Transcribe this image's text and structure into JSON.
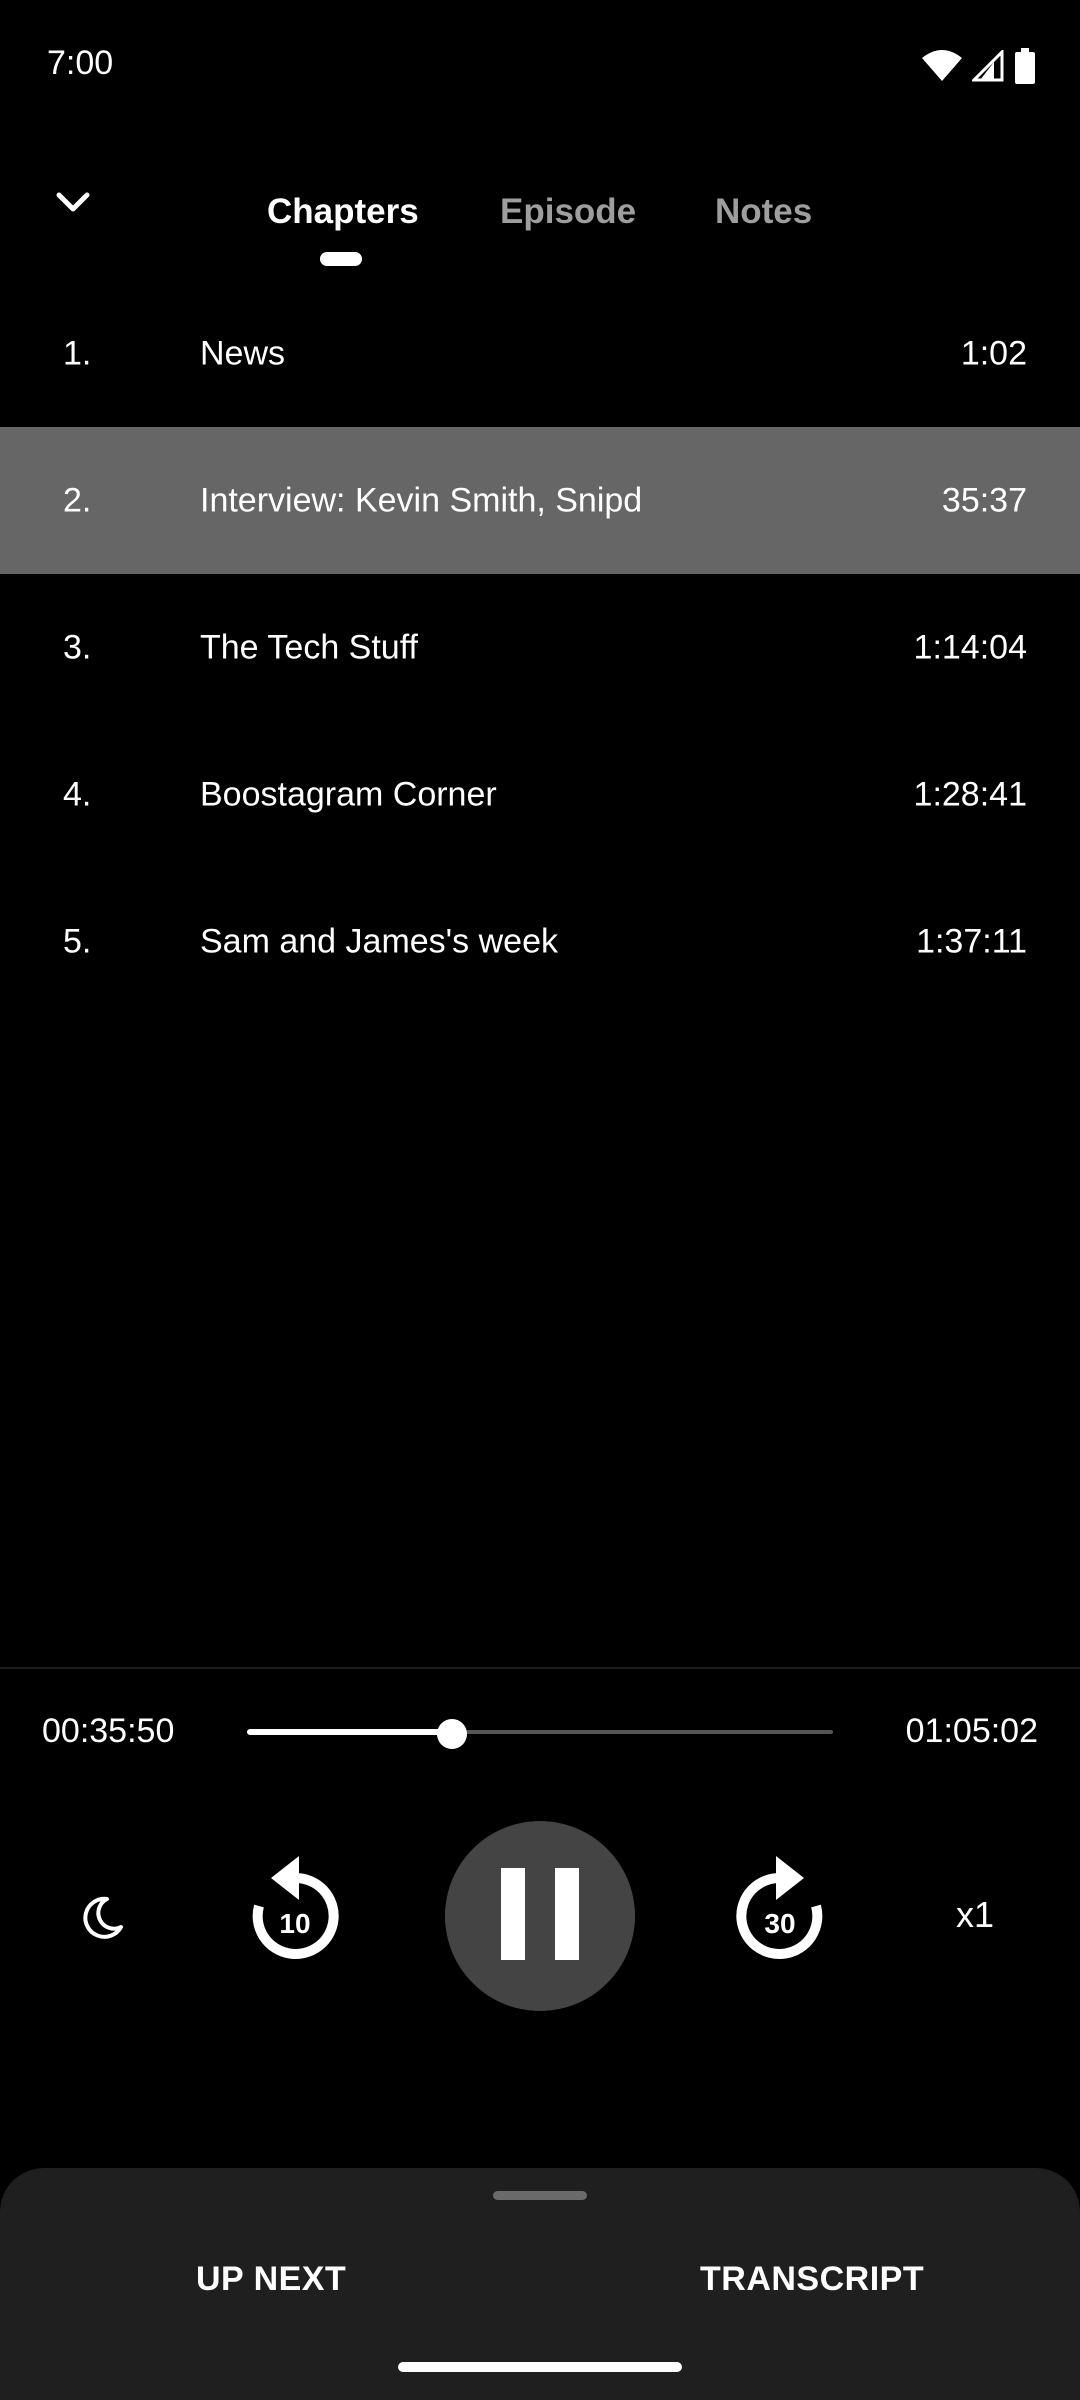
{
  "status_bar": {
    "time": "7:00",
    "icons": [
      "wifi-icon",
      "signal-icon",
      "battery-icon"
    ]
  },
  "header": {
    "collapse_icon": "chevron-down-icon",
    "tabs": [
      {
        "label": "Chapters",
        "active": true
      },
      {
        "label": "Episode",
        "active": false
      },
      {
        "label": "Notes",
        "active": false
      }
    ]
  },
  "chapters": [
    {
      "number": "1.",
      "title": "News",
      "time": "1:02",
      "selected": false
    },
    {
      "number": "2.",
      "title": "Interview: Kevin Smith, Snipd",
      "time": "35:37",
      "selected": true
    },
    {
      "number": "3.",
      "title": "The Tech Stuff",
      "time": "1:14:04",
      "selected": false
    },
    {
      "number": "4.",
      "title": "Boostagram Corner",
      "time": "1:28:41",
      "selected": false
    },
    {
      "number": "5.",
      "title": "Sam and James's week",
      "time": "1:37:11",
      "selected": false
    }
  ],
  "player": {
    "elapsed": "00:35:50",
    "total": "01:05:02",
    "progress_fraction": 0.35,
    "rewind_seconds": "10",
    "forward_seconds": "30",
    "speed": "x1",
    "sleep_icon": "moon-icon",
    "play_state_icon": "pause-icon"
  },
  "bottom_sheet": {
    "up_next_label": "UP NEXT",
    "transcript_label": "TRANSCRIPT"
  },
  "colors": {
    "background": "#000000",
    "selected_row": "#666666",
    "play_button": "#444444",
    "sheet": "#1f1f1f",
    "inactive_tab": "#9e9e9e"
  }
}
